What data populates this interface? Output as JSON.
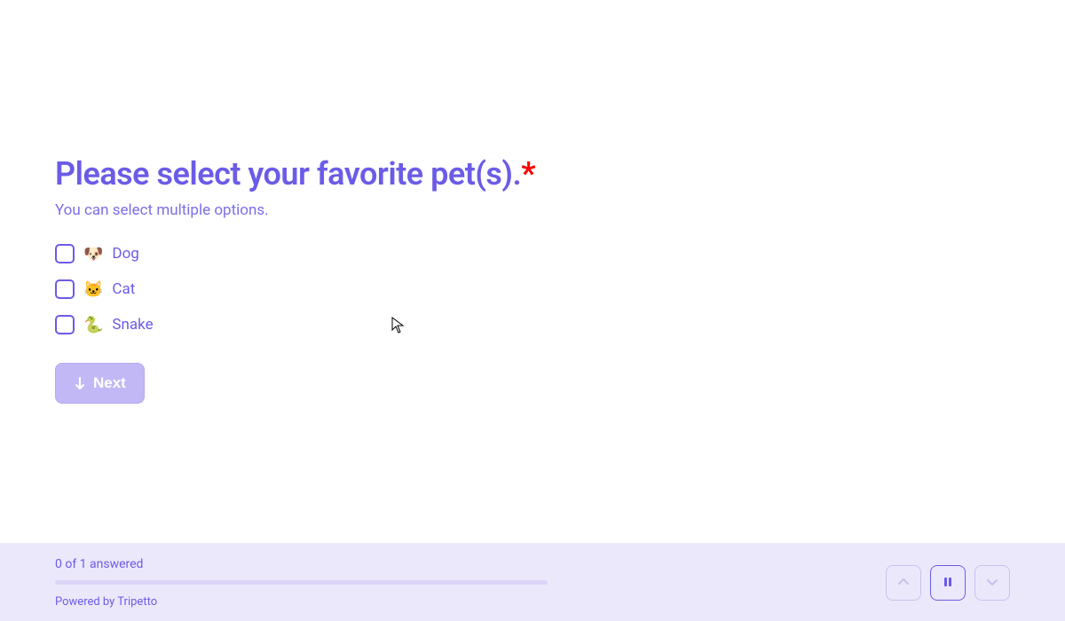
{
  "question": {
    "title": "Please select your favorite pet(s).",
    "required": true,
    "help_text": "You can select multiple options."
  },
  "options": [
    {
      "emoji": "🐶",
      "label": "Dog"
    },
    {
      "emoji": "🐱",
      "label": "Cat"
    },
    {
      "emoji": "🐍",
      "label": "Snake"
    }
  ],
  "next_button": {
    "label": "Next"
  },
  "footer": {
    "progress_text": "0 of 1 answered",
    "powered_by": "Powered by Tripetto"
  }
}
